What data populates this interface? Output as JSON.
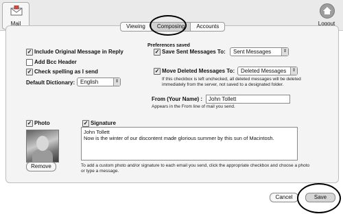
{
  "toolbar": {
    "app_label": "Mail",
    "logout_label": "Logout"
  },
  "tabs": [
    {
      "label": "Viewing"
    },
    {
      "label": "Composing",
      "active": true
    },
    {
      "label": "Accounts"
    }
  ],
  "status": "Preferences saved",
  "left": {
    "include_original": {
      "label": "Include Original Message in Reply",
      "checked": true
    },
    "add_bcc": {
      "label": "Add Bcc Header",
      "checked": false
    },
    "check_spelling": {
      "label": "Check spelling as I send",
      "checked": true
    },
    "dictionary": {
      "label": "Default Dictionary:",
      "value": "English"
    }
  },
  "right": {
    "save_sent": {
      "label": "Save Sent Messages To:",
      "checked": true,
      "value": "Sent Messages"
    },
    "move_deleted": {
      "label": "Move Deleted Messages To:",
      "checked": true,
      "value": "Deleted Messages",
      "help": "If this checkbox is left unchecked, all deleted messages will be deleted immediately from the server, not saved to a designated folder."
    },
    "from": {
      "label": "From (Your Name) :",
      "value": "John Tollett",
      "help": "Appears in the From line of mail you send."
    }
  },
  "photo": {
    "label": "Photo",
    "checked": true,
    "remove_label": "Remove"
  },
  "signature": {
    "label": "Signature",
    "checked": true,
    "text": "John Tollett\nNow is the winter of our discontent made glorious summer by this sun of Macintosh.",
    "help": "To add a custom photo and/or signature to each email you send, click the appropriate checkbox and choose a photo or type a message."
  },
  "footer": {
    "cancel_label": "Cancel",
    "save_label": "Save"
  },
  "icons": {
    "check": "checkmark-icon",
    "popup": "popup-arrows-icon"
  }
}
